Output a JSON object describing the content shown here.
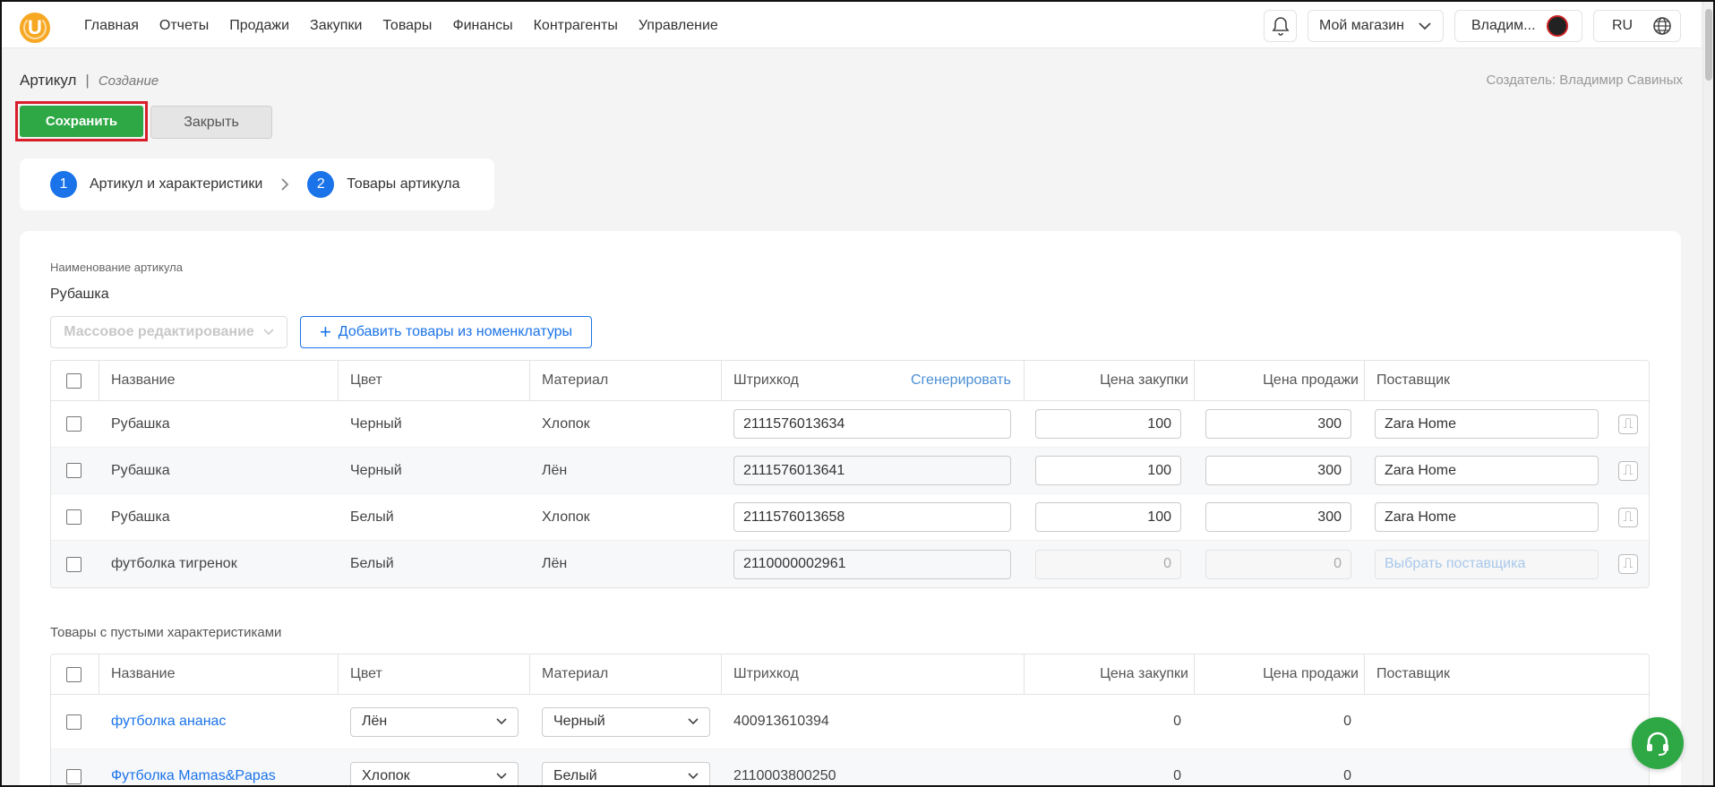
{
  "header": {
    "logo_letter": "U",
    "nav": [
      "Главная",
      "Отчеты",
      "Продажи",
      "Закупки",
      "Товары",
      "Финансы",
      "Контрагенты",
      "Управление"
    ],
    "shop": "Мой магазин",
    "user": "Владим...",
    "lang": "RU"
  },
  "breadcrumb": {
    "title": "Артикул",
    "sep": "|",
    "mode": "Создание"
  },
  "creator": "Создатель: Владимир Савиных",
  "actions": {
    "save": "Сохранить",
    "close": "Закрыть"
  },
  "steps": [
    {
      "num": "1",
      "label": "Артикул и характеристики"
    },
    {
      "num": "2",
      "label": "Товары артикула"
    }
  ],
  "article": {
    "label": "Наименование артикула",
    "value": "Рубашка"
  },
  "toolbar": {
    "mass_edit": "Массовое редактирование",
    "add_from_catalog": "Добавить товары из номенклатуры"
  },
  "table1": {
    "headers": {
      "name": "Название",
      "color": "Цвет",
      "material": "Материал",
      "barcode": "Штрихкод",
      "generate": "Сгенерировать",
      "purchase": "Цена закупки",
      "sale": "Цена продажи",
      "supplier": "Поставщик"
    },
    "rows": [
      {
        "name": "Рубашка",
        "color": "Черный",
        "material": "Хлопок",
        "barcode": "2111576013634",
        "purchase": "100",
        "sale": "300",
        "supplier": "Zara Home"
      },
      {
        "name": "Рубашка",
        "color": "Черный",
        "material": "Лён",
        "barcode": "2111576013641",
        "purchase": "100",
        "sale": "300",
        "supplier": "Zara Home"
      },
      {
        "name": "Рубашка",
        "color": "Белый",
        "material": "Хлопок",
        "barcode": "2111576013658",
        "purchase": "100",
        "sale": "300",
        "supplier": "Zara Home"
      },
      {
        "name": "футболка тигренок",
        "color": "Белый",
        "material": "Лён",
        "barcode": "2110000002961",
        "purchase": "0",
        "sale": "0",
        "supplier_placeholder": "Выбрать поставщика"
      }
    ]
  },
  "section2_title": "Товары с пустыми характеристиками",
  "table2": {
    "headers": {
      "name": "Название",
      "color": "Цвет",
      "material": "Материал",
      "barcode": "Штрихкод",
      "purchase": "Цена закупки",
      "sale": "Цена продажи",
      "supplier": "Поставщик"
    },
    "rows": [
      {
        "name": "футболка ананас",
        "color": "Лён",
        "material": "Черный",
        "barcode": "400913610394",
        "purchase": "0",
        "sale": "0"
      },
      {
        "name": "Футболка Mamas&Papas",
        "color": "Хлопок",
        "material": "Белый",
        "barcode": "2110003800250",
        "purchase": "0",
        "sale": "0"
      }
    ]
  },
  "colors": {
    "accent_green": "#2ea845",
    "accent_blue": "#1a73e8",
    "highlight_red": "#d91e2b"
  }
}
